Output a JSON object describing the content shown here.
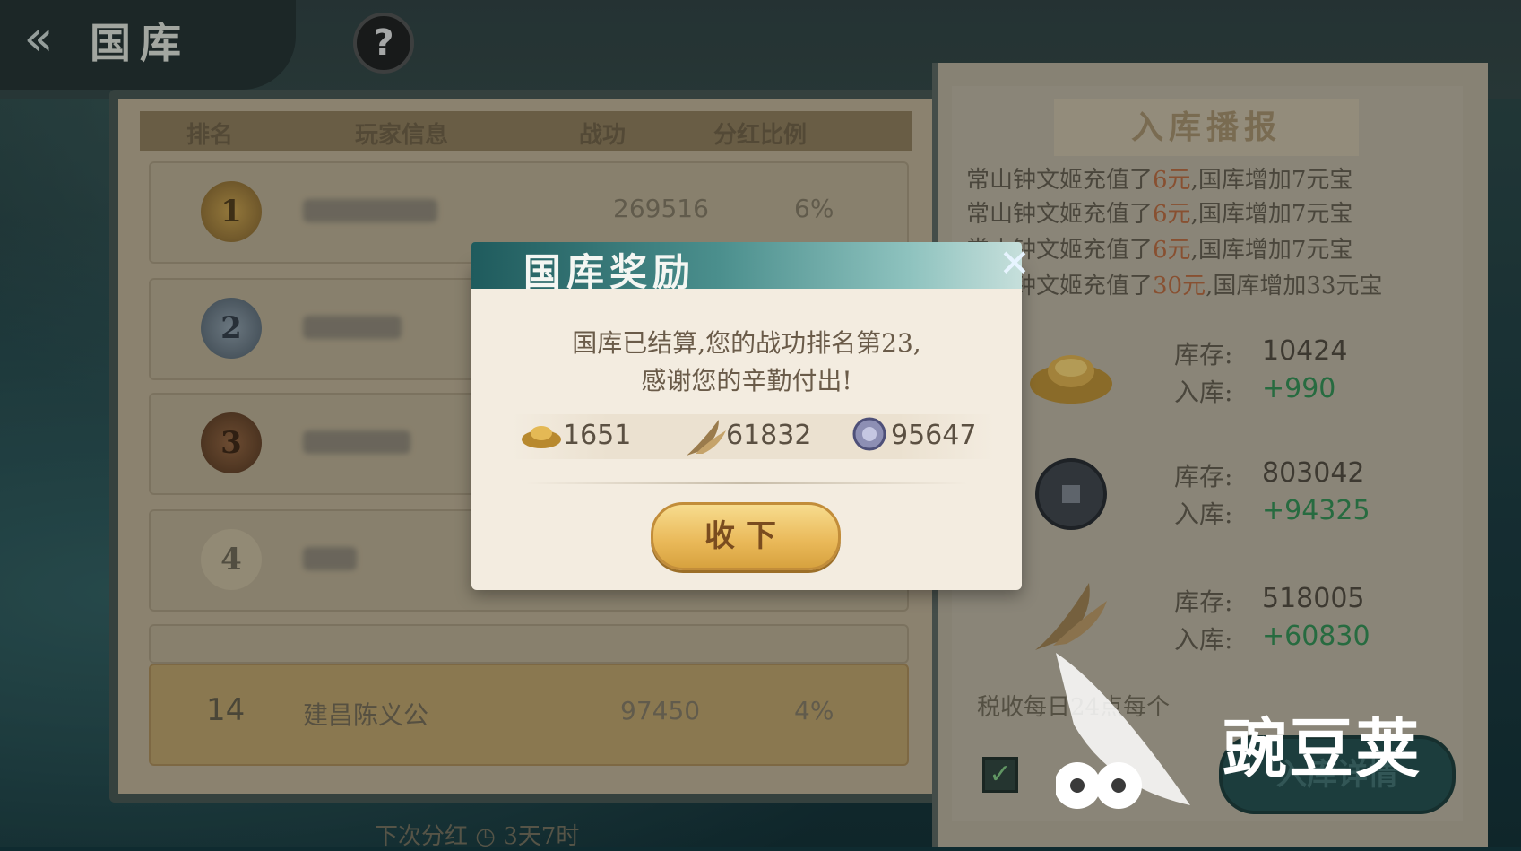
{
  "header": {
    "title": "国库",
    "back_icon": "back-arrow-icon",
    "help_icon": "help-icon"
  },
  "ranking": {
    "columns": [
      "排名",
      "玩家信息",
      "战功",
      "分红比例"
    ],
    "rows": [
      {
        "rank": "1",
        "score": "269516",
        "pct": "6%"
      },
      {
        "rank": "2"
      },
      {
        "rank": "3"
      },
      {
        "rank": "4"
      }
    ],
    "self_row": {
      "rank": "14",
      "name": "建昌陈义公",
      "score": "97450",
      "pct": "4%"
    },
    "next_dividend_label": "下次分红",
    "next_dividend_time": "3天7时"
  },
  "broadcast": {
    "title": "入库播报",
    "lines": [
      {
        "pre": "常山钟文姬充值了",
        "amt": "6元",
        "post": ",国库增加7元宝"
      },
      {
        "pre": "常山钟文姬充值了",
        "amt": "6元",
        "post": ",国库增加7元宝"
      },
      {
        "pre": "常山钟文姬充值了",
        "amt": "6元",
        "post": ",国库增加7元宝"
      },
      {
        "pre": "常山钟文姬充值了",
        "amt": "30元",
        "post": ",国库增加33元宝"
      }
    ]
  },
  "treasury": [
    {
      "icon": "gold-ingot-icon",
      "stock_label": "库存:",
      "stock": "10424",
      "in_label": "入库:",
      "in": "+990"
    },
    {
      "icon": "coin-icon",
      "stock_label": "库存:",
      "stock": "803042",
      "in_label": "入库:",
      "in": "+94325"
    },
    {
      "icon": "grain-icon",
      "stock_label": "库存:",
      "stock": "518005",
      "in_label": "入库:",
      "in": "+60830"
    }
  ],
  "tax_line": "税收每日24点每个",
  "detail_button": "入库详情",
  "modal": {
    "title": "国库奖励",
    "message_line1": "国库已结算,您的战功排名第23,",
    "message_line2": "感谢您的辛勤付出!",
    "rewards": [
      {
        "icon": "gold-ingot-icon",
        "amount": "1651"
      },
      {
        "icon": "grain-icon",
        "amount": "61832"
      },
      {
        "icon": "silver-coin-icon",
        "amount": "95647"
      }
    ],
    "collect_button": "收下",
    "close_icon": "close-icon"
  },
  "watermark": {
    "text": "豌豆荚",
    "icon": "pea-logo-icon"
  },
  "colors": {
    "accent_green": "#2e8a4e",
    "highlight": "#b4643a",
    "button_gold": "#e9b858"
  }
}
